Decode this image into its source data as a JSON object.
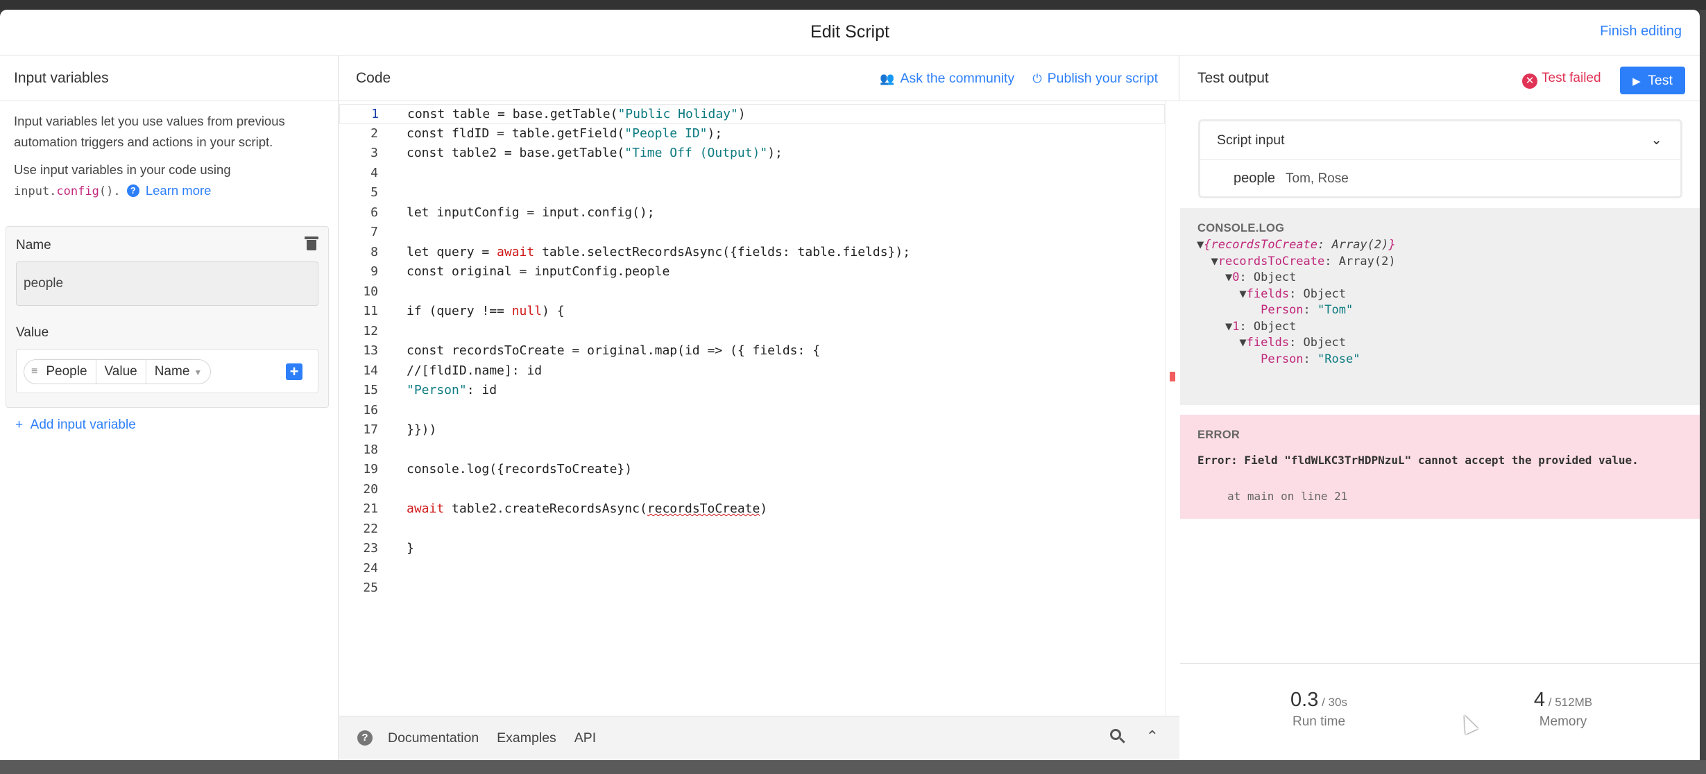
{
  "header": {
    "title": "Edit Script",
    "finish_label": "Finish editing"
  },
  "left": {
    "title": "Input variables",
    "desc": "Input variables let you use values from previous automation triggers and actions in your script.",
    "usage_prefix": "Use input variables in your code using",
    "usage_code_a": "input.",
    "usage_code_b": "config",
    "usage_code_c": "().",
    "learn_more": "Learn more",
    "name_label": "Name",
    "name_value": "people",
    "value_label": "Value",
    "pill": [
      "People",
      "Value",
      "Name"
    ],
    "add_label": "Add input variable"
  },
  "code": {
    "title": "Code",
    "ask_label": "Ask the community",
    "publish_label": "Publish your script",
    "footer_links": [
      "Documentation",
      "Examples",
      "API"
    ]
  },
  "right": {
    "title": "Test output",
    "status": "Test failed",
    "test_label": "Test",
    "script_input_title": "Script input",
    "input_key": "people",
    "input_value": "Tom, Rose",
    "console_label": "CONSOLE.LOG",
    "error_label": "ERROR",
    "error_message": "Error: Field \"fldWLKC3TrHDPNzuL\" cannot accept the provided value.",
    "error_at": "at main on line 21",
    "runtime_value": "0.3",
    "runtime_unit": " / 30s",
    "runtime_label": "Run time",
    "memory_value": "4",
    "memory_unit": " / 512MB",
    "memory_label": "Memory"
  }
}
